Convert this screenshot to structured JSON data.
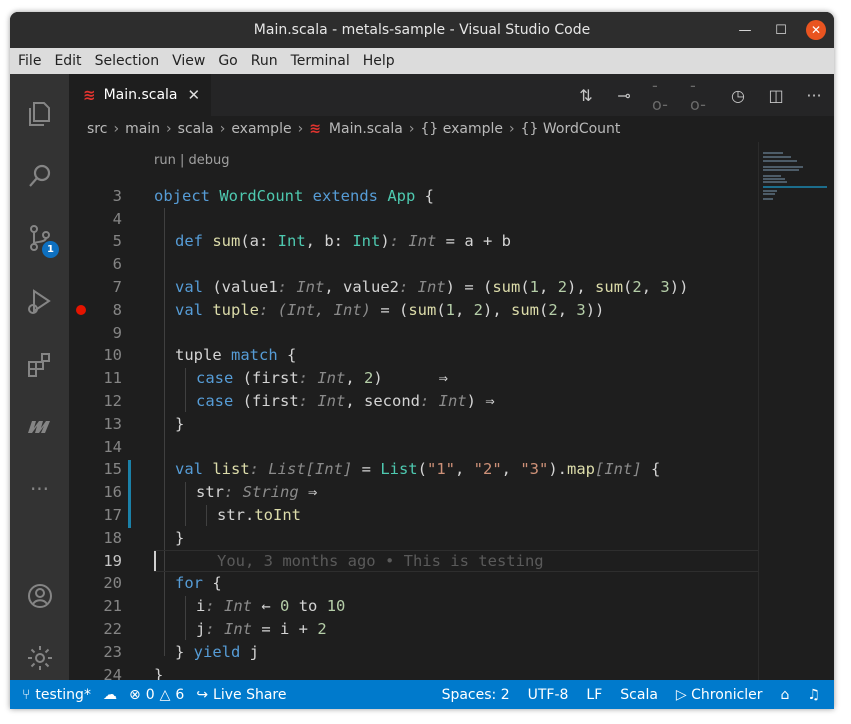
{
  "window": {
    "title": "Main.scala - metals-sample - Visual Studio Code"
  },
  "menu": [
    "File",
    "Edit",
    "Selection",
    "View",
    "Go",
    "Run",
    "Terminal",
    "Help"
  ],
  "activity": {
    "scm_badge": "1"
  },
  "tab": {
    "label": "Main.scala",
    "close": "✕"
  },
  "breadcrumbs": [
    "src",
    "main",
    "scala",
    "example",
    "Main.scala",
    "{} example",
    "{} WordCount"
  ],
  "codelens": "run | debug",
  "line_numbers": [
    "3",
    "4",
    "5",
    "6",
    "7",
    "8",
    "9",
    "10",
    "11",
    "12",
    "13",
    "14",
    "15",
    "16",
    "17",
    "18",
    "19",
    "20",
    "21",
    "22",
    "23",
    "24"
  ],
  "code": {
    "l3a": "object ",
    "l3b": "WordCount",
    "l3c": " extends ",
    "l3d": "App",
    "l3e": " {",
    "l5a": "def ",
    "l5b": "sum",
    "l5c": "(a: ",
    "l5d": "Int",
    "l5e": ", b: ",
    "l5f": "Int",
    "l5g": ")",
    "l5h": ": Int",
    "l5i": " = a + b",
    "l7a": "val ",
    "l7b": "(value1",
    "l7c": ": Int",
    "l7d": ", value2",
    "l7e": ": Int",
    "l7f": ") = (",
    "l7g": "sum",
    "l7h": "(",
    "l7i": "1",
    "l7j": ", ",
    "l7k": "2",
    "l7l": "), ",
    "l7m": "sum",
    "l7n": "(",
    "l7o": "2",
    "l7p": ", ",
    "l7q": "3",
    "l7r": "))",
    "l8a": "val ",
    "l8b": "tuple",
    "l8c": ": (Int, Int)",
    "l8d": " = (",
    "l8e": "sum",
    "l8f": "(",
    "l8g": "1",
    "l8h": ", ",
    "l8i": "2",
    "l8j": "), ",
    "l8k": "sum",
    "l8l": "(",
    "l8m": "2",
    "l8n": ", ",
    "l8o": "3",
    "l8p": "))",
    "l10a": "tuple ",
    "l10b": "match",
    "l10c": " {",
    "l11a": "case",
    "l11b": " (first",
    "l11c": ": Int",
    "l11d": ", ",
    "l11e": "2",
    "l11f": ")      ⇒",
    "l12a": "case",
    "l12b": " (first",
    "l12c": ": Int",
    "l12d": ", second",
    "l12e": ": Int",
    "l12f": ") ⇒",
    "l13a": "}",
    "l15a": "val ",
    "l15b": "list",
    "l15c": ": List[Int]",
    "l15d": " = ",
    "l15e": "List",
    "l15f": "(",
    "l15g": "\"1\"",
    "l15h": ", ",
    "l15i": "\"2\"",
    "l15j": ", ",
    "l15k": "\"3\"",
    "l15l": ").",
    "l15m": "map",
    "l15n": "[Int]",
    "l15o": " {",
    "l16a": "str",
    "l16b": ": String",
    "l16c": " ⇒",
    "l17a": "str.",
    "l17b": "toInt",
    "l18a": "}",
    "l19a": "You, 3 months ago • This is testing",
    "l20a": "for",
    "l20b": " {",
    "l21a": "i",
    "l21b": ": Int",
    "l21c": " ← ",
    "l21d": "0",
    "l21e": " to ",
    "l21f": "10",
    "l22a": "j",
    "l22b": ": Int",
    "l22c": " = i + ",
    "l22d": "2",
    "l23a": "} ",
    "l23b": "yield",
    "l23c": " j",
    "l24a": "}"
  },
  "statusbar": {
    "branch": "testing*",
    "errors": "0",
    "warnings": "6",
    "live_share": "Live Share",
    "spaces": "Spaces: 2",
    "encoding": "UTF-8",
    "eol": "LF",
    "language": "Scala",
    "chronicler": "Chronicler"
  },
  "colors": {
    "accent": "#007acc",
    "breakpoint": "#e51400",
    "scala_icon": "#e3342f"
  },
  "icons": [
    "explorer-icon",
    "search-icon",
    "source-control-icon",
    "run-debug-icon",
    "extensions-icon",
    "metals-icon",
    "more-icon",
    "account-icon",
    "manage-gear-icon"
  ]
}
